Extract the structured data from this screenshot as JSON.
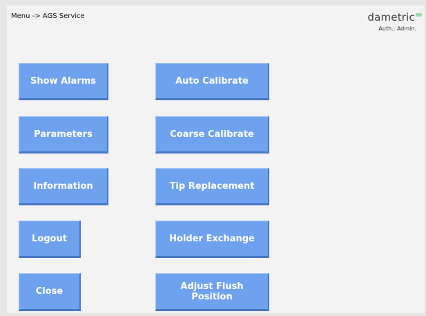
{
  "header": {
    "breadcrumb": "Menu -> AGS Service",
    "logo_text": "dametric",
    "auth": "Auth.: Admin."
  },
  "buttons": {
    "show_alarms": "Show Alarms",
    "parameters": "Parameters",
    "information": "Information",
    "logout": "Logout",
    "close": "Close",
    "auto_calibrate": "Auto Calibrate",
    "coarse_calibrate": "Coarse Calibrate",
    "tip_replacement": "Tip Replacement",
    "holder_exchange": "Holder Exchange",
    "adjust_flush_position": "Adjust Flush Position"
  },
  "colors": {
    "button_face": "#6fa2ee",
    "button_text": "#ffffff",
    "background": "#f3f3f3",
    "logo_accent": "#9fd8b0"
  }
}
